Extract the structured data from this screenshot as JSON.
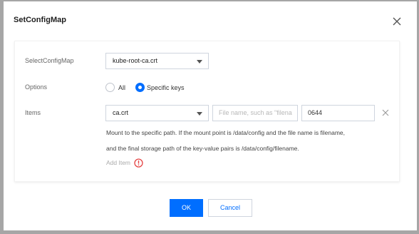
{
  "dialog": {
    "title": "SetConfigMap",
    "close_icon": "close-icon"
  },
  "form": {
    "select_configmap": {
      "label": "SelectConfigMap",
      "value": "kube-root-ca.crt"
    },
    "options": {
      "label": "Options",
      "choices": [
        {
          "label": "All",
          "checked": false
        },
        {
          "label": "Specific keys",
          "checked": true
        }
      ]
    },
    "items": {
      "label": "Items",
      "rows": [
        {
          "key": "ca.crt",
          "file_name_placeholder": "File name, such as \"filena",
          "mode": "0644"
        }
      ],
      "help_line1": "Mount to the specific path. If the mount point is /data/config and the file name is filename,",
      "help_line2": "and the final storage path of the key-value pairs is /data/config/filename.",
      "add_item_label": "Add Item"
    }
  },
  "footer": {
    "ok_label": "OK",
    "cancel_label": "Cancel"
  },
  "colors": {
    "primary": "#006eff",
    "warning": "#e54545",
    "overlay": "#a6a6a6"
  }
}
